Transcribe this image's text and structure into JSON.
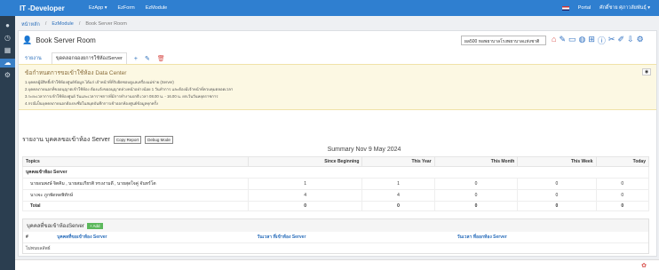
{
  "brand": "IT -Developer",
  "topnav": [
    "EzApp ▾",
    "EzForm",
    "EzModule"
  ],
  "topright": {
    "portal": "Portal",
    "user": "ศักดิ์ชาย ศุภาวลัยพันธุ์ ▾"
  },
  "breadcrumb": [
    "หน้าหลัก",
    "EzModule",
    "Book Server Room"
  ],
  "page_title": "Book Server Room",
  "select_value": "ผล500 หอพยาบาลโรงพยาบาลแห่งชาติ",
  "tabs": {
    "report": "รายงาน",
    "booking": "ขุดคลอกจองยการใช้ห้องServer"
  },
  "alert": {
    "title": "ข้อกำหนดการขอเข้าใช้ห้อง Data Center",
    "rules": [
      "1.บุคคลผู้มีสิทธิ์เข้าใช้ห้องศูนย์ข้อมูล ได้แก่ เจ้าหน้าที่ที่รับผิดชอบดูแลเครื่องแม่ข่าย (Server)",
      "2.บุคคลภายนอกที่ขออนุญาตเข้าใช้ห้อง ต้องแจ้งขออนุญาตล่วงหน้าอย่างน้อย 1 วันทำการ และต้องมีเจ้าหน้าที่ควบคุมตลอดเวลา",
      "3.ระยะเวลาการเข้าใช้ห้องศูนย์ วันและเวลาราชการที่มีการทำงานปกติ เวลา 08.00 น. - 16.00 น. ยกเว้นวันหยุดราชการ",
      "4.กรณีเป็นบุคคลภายนอกต้องลงชื่อในสมุดบันทึกการเข้าออกห้องศูนย์ข้อมูลทุกครั้ง"
    ]
  },
  "report_title": "รายงาน บุคคลขอเข้าห้อง Server",
  "copy_report": "Copy Report",
  "debug_mode": "Debug Mode",
  "summary_title": "Summary Nov 9 May 2024",
  "summary_table": {
    "headers": [
      "Topics",
      "Since Beginning",
      "This Year",
      "This Month",
      "This Week",
      "Today"
    ],
    "group": "บุคคลเข้าห้อง Server",
    "rows": [
      {
        "topic": "นายอนพงษ์ จิตคิม , นายสมเกียรติ ทรงงามดี , นายสุดใจคู่ จันทร์โต",
        "v": [
          "1",
          "1",
          "0",
          "0",
          "0"
        ]
      },
      {
        "topic": "นางจะ ภูกพัดทดพิทักษ์",
        "v": [
          "4",
          "4",
          "0",
          "0",
          "0"
        ]
      }
    ],
    "total_label": "Total",
    "total": [
      "0",
      "0",
      "0",
      "0",
      "0"
    ]
  },
  "users": {
    "title": "บุคคลที่ขอเข้าห้องServer",
    "add": "+ Add",
    "headers": [
      "#",
      "บุคคลที่ขอเข้าห้อง Server",
      "วันเวลา ที่เข้าห้อง Server",
      "วันเวลา ที่ออกห้อง Server"
    ],
    "empty": "ไม่พบผลลัพธ์"
  }
}
